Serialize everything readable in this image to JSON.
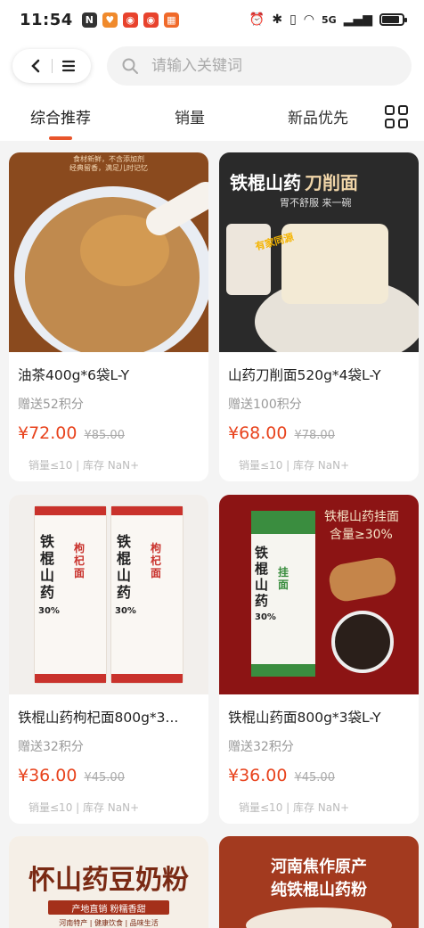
{
  "status_bar": {
    "time": "11:54",
    "network": "5G",
    "battery_level": 0.8
  },
  "header": {
    "search_placeholder": "请输入关键词"
  },
  "tabs": [
    {
      "label": "综合推荐",
      "active": true
    },
    {
      "label": "销量",
      "active": false
    },
    {
      "label": "新品优先",
      "active": false
    }
  ],
  "products": [
    {
      "title": "油茶400g*6袋L-Y",
      "points": "赠送52积分",
      "price": "¥72.00",
      "old_price": "¥85.00",
      "meta": "销量≤10 | 库存 NaN+",
      "image_text": {
        "top": "食材新鲜，不含添加剂",
        "top2": "经典留香，满足儿时记忆"
      }
    },
    {
      "title": "山药刀削面520g*4袋L-Y",
      "points": "赠送100积分",
      "price": "¥68.00",
      "old_price": "¥78.00",
      "meta": "销量≤10 | 库存 NaN+",
      "image_text": {
        "headline": "铁棍山药",
        "headline2": "刀削面",
        "sub": "胃不舒服 来一碗",
        "badge": "有家同源"
      }
    },
    {
      "title": "铁棍山药枸杞面800g*3...",
      "points": "赠送32积分",
      "price": "¥36.00",
      "old_price": "¥45.00",
      "meta": "销量≤10 | 库存 NaN+",
      "image_text": {
        "brand": "铁棍山药",
        "variety": "枸杞面",
        "ratio": "30%"
      }
    },
    {
      "title": "铁棍山药面800g*3袋L-Y",
      "points": "赠送32积分",
      "price": "¥36.00",
      "old_price": "¥45.00",
      "meta": "销量≤10 | 库存 NaN+",
      "image_text": {
        "headline": "铁棍山药挂面",
        "sub": "含量≥30%",
        "brand": "铁棍山药",
        "variety": "挂面",
        "ratio": "30%"
      }
    },
    {
      "image_text": {
        "headline": "怀山药豆奶粉",
        "sub": "产地直销 粉糯香甜",
        "tag": "河南特产 | 健康饮食 | 品味生活"
      }
    },
    {
      "image_text": {
        "headline": "河南焦作原产",
        "sub": "纯铁棍山药粉"
      }
    }
  ],
  "colors": {
    "accent": "#e8552b",
    "price": "#e8431d"
  }
}
